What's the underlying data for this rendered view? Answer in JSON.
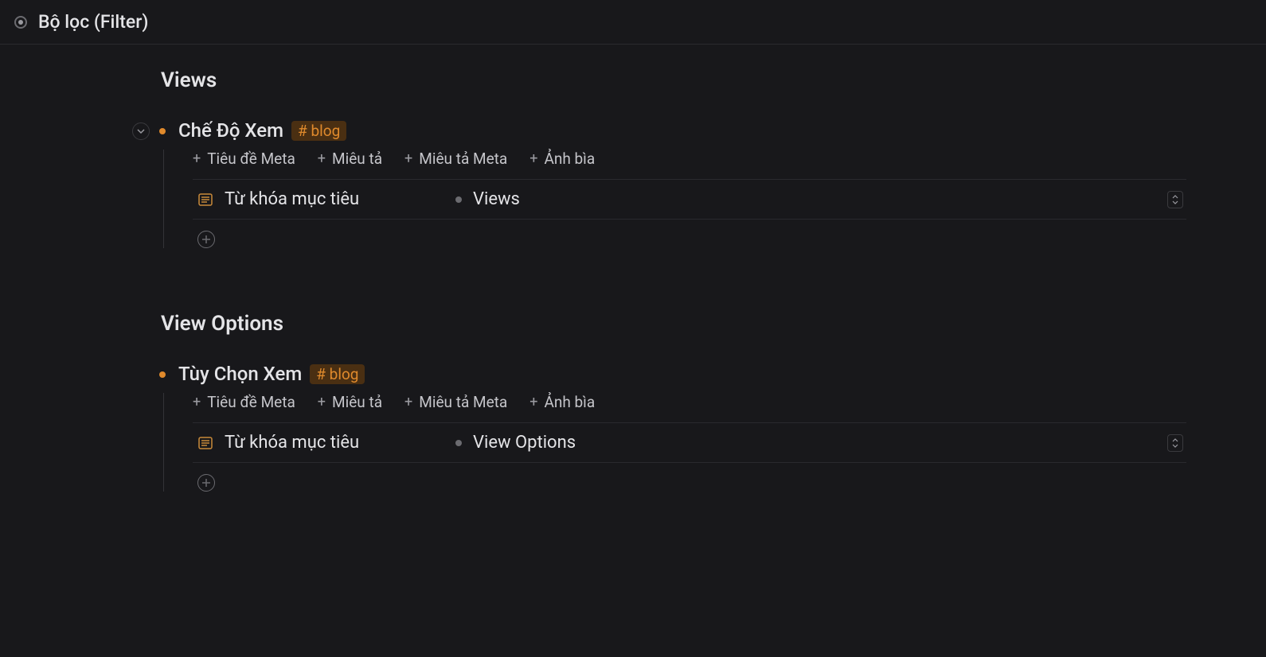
{
  "header": {
    "title": "Bộ lọc (Filter)"
  },
  "groups": [
    {
      "title": "Views",
      "collapsible": true,
      "item": {
        "title": "Chế Độ Xem",
        "tag": "# blog",
        "metaButtons": [
          "Tiêu đề Meta",
          "Miêu tả",
          "Miêu tả Meta",
          "Ảnh bìa"
        ],
        "property": {
          "label": "Từ khóa mục tiêu",
          "value": "Views"
        }
      }
    },
    {
      "title": "View Options",
      "collapsible": false,
      "item": {
        "title": "Tùy Chọn Xem",
        "tag": "# blog",
        "metaButtons": [
          "Tiêu đề Meta",
          "Miêu tả",
          "Miêu tả Meta",
          "Ảnh bìa"
        ],
        "property": {
          "label": "Từ khóa mục tiêu",
          "value": "View Options"
        }
      }
    }
  ]
}
